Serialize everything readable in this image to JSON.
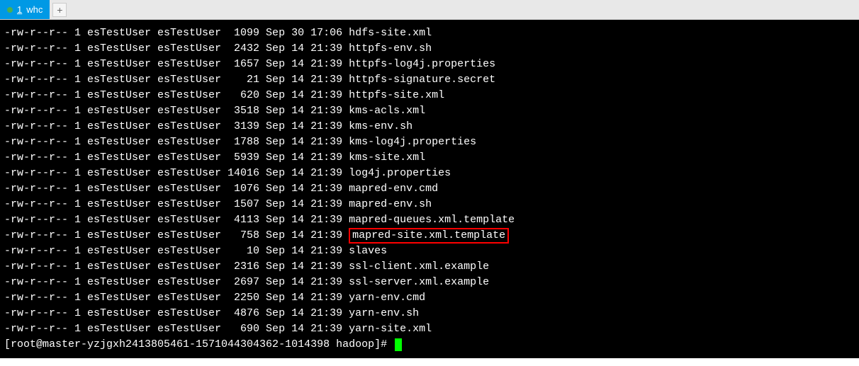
{
  "tab": {
    "number": "1",
    "label": "whc"
  },
  "addTabLabel": "+",
  "files": [
    {
      "perms": "-rw-r--r--",
      "links": "1",
      "owner": "esTestUser",
      "group": "esTestUser",
      "size": " 1099",
      "month": "Sep",
      "day": "30",
      "time": "17:06",
      "name": "hdfs-site.xml",
      "highlighted": false
    },
    {
      "perms": "-rw-r--r--",
      "links": "1",
      "owner": "esTestUser",
      "group": "esTestUser",
      "size": " 2432",
      "month": "Sep",
      "day": "14",
      "time": "21:39",
      "name": "httpfs-env.sh",
      "highlighted": false
    },
    {
      "perms": "-rw-r--r--",
      "links": "1",
      "owner": "esTestUser",
      "group": "esTestUser",
      "size": " 1657",
      "month": "Sep",
      "day": "14",
      "time": "21:39",
      "name": "httpfs-log4j.properties",
      "highlighted": false
    },
    {
      "perms": "-rw-r--r--",
      "links": "1",
      "owner": "esTestUser",
      "group": "esTestUser",
      "size": "   21",
      "month": "Sep",
      "day": "14",
      "time": "21:39",
      "name": "httpfs-signature.secret",
      "highlighted": false
    },
    {
      "perms": "-rw-r--r--",
      "links": "1",
      "owner": "esTestUser",
      "group": "esTestUser",
      "size": "  620",
      "month": "Sep",
      "day": "14",
      "time": "21:39",
      "name": "httpfs-site.xml",
      "highlighted": false
    },
    {
      "perms": "-rw-r--r--",
      "links": "1",
      "owner": "esTestUser",
      "group": "esTestUser",
      "size": " 3518",
      "month": "Sep",
      "day": "14",
      "time": "21:39",
      "name": "kms-acls.xml",
      "highlighted": false
    },
    {
      "perms": "-rw-r--r--",
      "links": "1",
      "owner": "esTestUser",
      "group": "esTestUser",
      "size": " 3139",
      "month": "Sep",
      "day": "14",
      "time": "21:39",
      "name": "kms-env.sh",
      "highlighted": false
    },
    {
      "perms": "-rw-r--r--",
      "links": "1",
      "owner": "esTestUser",
      "group": "esTestUser",
      "size": " 1788",
      "month": "Sep",
      "day": "14",
      "time": "21:39",
      "name": "kms-log4j.properties",
      "highlighted": false
    },
    {
      "perms": "-rw-r--r--",
      "links": "1",
      "owner": "esTestUser",
      "group": "esTestUser",
      "size": " 5939",
      "month": "Sep",
      "day": "14",
      "time": "21:39",
      "name": "kms-site.xml",
      "highlighted": false
    },
    {
      "perms": "-rw-r--r--",
      "links": "1",
      "owner": "esTestUser",
      "group": "esTestUser",
      "size": "14016",
      "month": "Sep",
      "day": "14",
      "time": "21:39",
      "name": "log4j.properties",
      "highlighted": false
    },
    {
      "perms": "-rw-r--r--",
      "links": "1",
      "owner": "esTestUser",
      "group": "esTestUser",
      "size": " 1076",
      "month": "Sep",
      "day": "14",
      "time": "21:39",
      "name": "mapred-env.cmd",
      "highlighted": false
    },
    {
      "perms": "-rw-r--r--",
      "links": "1",
      "owner": "esTestUser",
      "group": "esTestUser",
      "size": " 1507",
      "month": "Sep",
      "day": "14",
      "time": "21:39",
      "name": "mapred-env.sh",
      "highlighted": false
    },
    {
      "perms": "-rw-r--r--",
      "links": "1",
      "owner": "esTestUser",
      "group": "esTestUser",
      "size": " 4113",
      "month": "Sep",
      "day": "14",
      "time": "21:39",
      "name": "mapred-queues.xml.template",
      "highlighted": false
    },
    {
      "perms": "-rw-r--r--",
      "links": "1",
      "owner": "esTestUser",
      "group": "esTestUser",
      "size": "  758",
      "month": "Sep",
      "day": "14",
      "time": "21:39",
      "name": "mapred-site.xml.template",
      "highlighted": true
    },
    {
      "perms": "-rw-r--r--",
      "links": "1",
      "owner": "esTestUser",
      "group": "esTestUser",
      "size": "   10",
      "month": "Sep",
      "day": "14",
      "time": "21:39",
      "name": "slaves",
      "highlighted": false
    },
    {
      "perms": "-rw-r--r--",
      "links": "1",
      "owner": "esTestUser",
      "group": "esTestUser",
      "size": " 2316",
      "month": "Sep",
      "day": "14",
      "time": "21:39",
      "name": "ssl-client.xml.example",
      "highlighted": false
    },
    {
      "perms": "-rw-r--r--",
      "links": "1",
      "owner": "esTestUser",
      "group": "esTestUser",
      "size": " 2697",
      "month": "Sep",
      "day": "14",
      "time": "21:39",
      "name": "ssl-server.xml.example",
      "highlighted": false
    },
    {
      "perms": "-rw-r--r--",
      "links": "1",
      "owner": "esTestUser",
      "group": "esTestUser",
      "size": " 2250",
      "month": "Sep",
      "day": "14",
      "time": "21:39",
      "name": "yarn-env.cmd",
      "highlighted": false
    },
    {
      "perms": "-rw-r--r--",
      "links": "1",
      "owner": "esTestUser",
      "group": "esTestUser",
      "size": " 4876",
      "month": "Sep",
      "day": "14",
      "time": "21:39",
      "name": "yarn-env.sh",
      "highlighted": false
    },
    {
      "perms": "-rw-r--r--",
      "links": "1",
      "owner": "esTestUser",
      "group": "esTestUser",
      "size": "  690",
      "month": "Sep",
      "day": "14",
      "time": "21:39",
      "name": "yarn-site.xml",
      "highlighted": false
    }
  ],
  "prompt": "[root@master-yzjgxh2413805461-1571044304362-1014398 hadoop]# "
}
